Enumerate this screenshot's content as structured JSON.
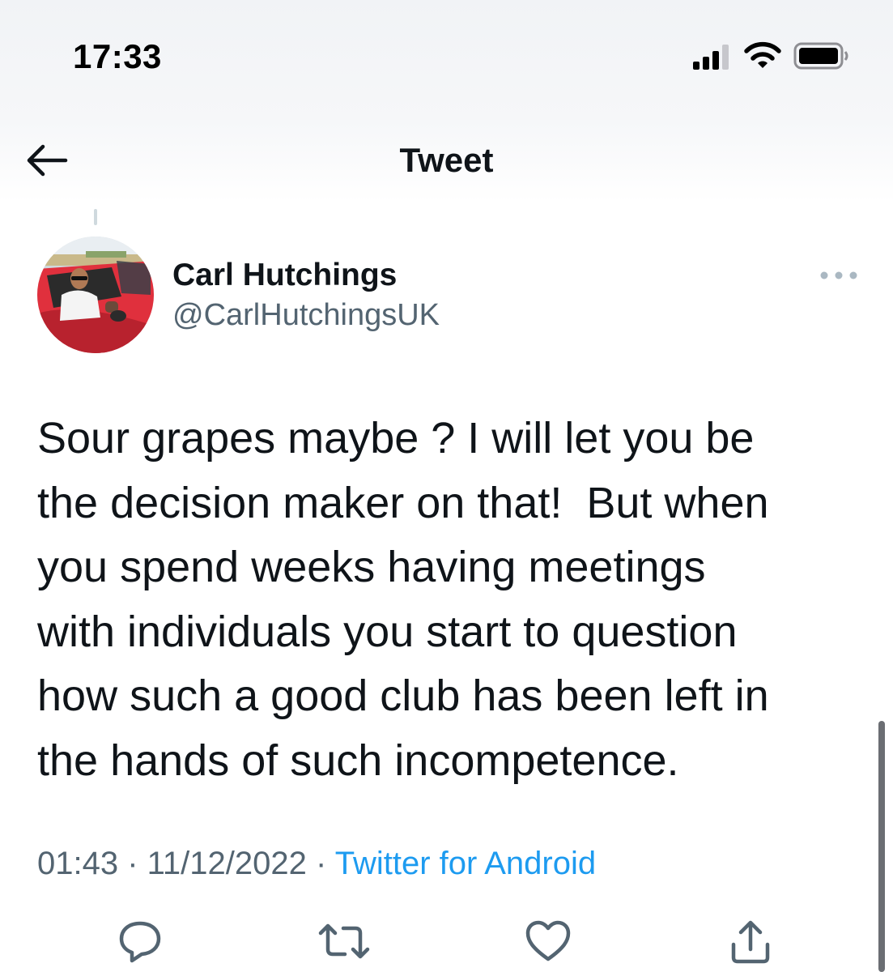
{
  "status_bar": {
    "time": "17:33",
    "icons": [
      "cellular-signal-icon",
      "wifi-icon",
      "battery-icon"
    ]
  },
  "header": {
    "title": "Tweet",
    "back_icon": "arrow-left-icon"
  },
  "tweet": {
    "author_name": "Carl Hutchings",
    "author_handle": "@CarlHutchingsUK",
    "text": "Sour grapes maybe ? I will let you be\nthe decision maker on that!  But when\nyou spend weeks having meetings\nwith individuals you start to question\nhow such a good club has been left in\nthe hands of such incompetence.",
    "time": "01:43",
    "separator": " · ",
    "date": "11/12/2022",
    "source": "Twitter for Android"
  },
  "actions": [
    "reply-icon",
    "retweet-icon",
    "like-icon",
    "share-icon"
  ],
  "colors": {
    "text": "#0f1419",
    "secondary": "#536471",
    "link": "#1d9bf0"
  }
}
